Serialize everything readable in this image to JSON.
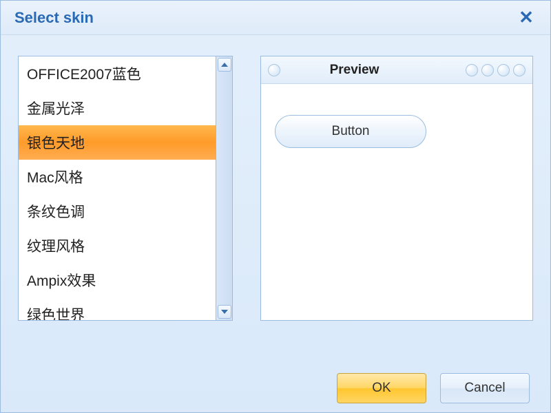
{
  "window": {
    "title": "Select skin"
  },
  "skins": {
    "items": [
      "OFFICE2007蓝色",
      "金属光泽",
      "银色天地",
      "Mac风格",
      "条纹色调",
      "纹理风格",
      "Ampix效果",
      "绿色世界"
    ],
    "selected_index": 2
  },
  "preview": {
    "title": "Preview",
    "button_label": "Button"
  },
  "footer": {
    "ok_label": "OK",
    "cancel_label": "Cancel"
  }
}
